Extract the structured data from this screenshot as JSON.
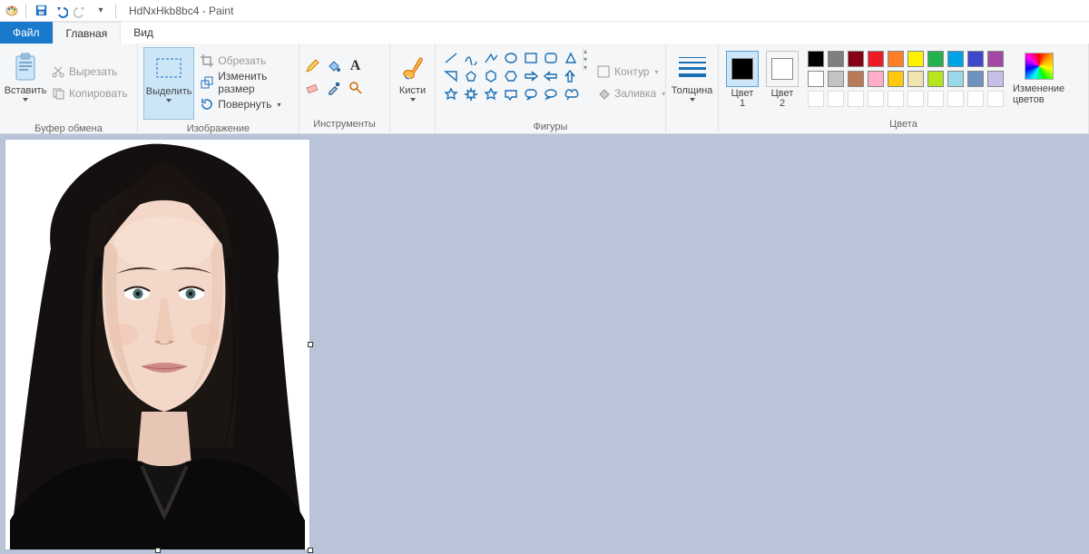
{
  "title": {
    "doc": "HdNxHkb8bc4",
    "app": "Paint",
    "sep": " - "
  },
  "tabs": {
    "file": "Файл",
    "home": "Главная",
    "view": "Вид"
  },
  "groups": {
    "clipboard": "Буфер обмена",
    "image": "Изображение",
    "tools": "Инструменты",
    "shapes": "Фигуры",
    "colors": "Цвета"
  },
  "clipboard": {
    "paste": "Вставить",
    "cut": "Вырезать",
    "copy": "Копировать"
  },
  "image": {
    "select": "Выделить",
    "crop": "Обрезать",
    "resize": "Изменить размер",
    "rotate": "Повернуть"
  },
  "brushes": {
    "label": "Кисти"
  },
  "shape_opts": {
    "outline": "Контур",
    "fill": "Заливка"
  },
  "thickness": {
    "label": "Толщина"
  },
  "colors": {
    "c1": "Цвет\n1",
    "c2": "Цвет\n2",
    "edit": "Изменение\nцветов"
  },
  "palette_row1": [
    "#000000",
    "#7f7f7f",
    "#880015",
    "#ed1c24",
    "#ff7f27",
    "#fff200",
    "#22b14c",
    "#00a2e8",
    "#3f48cc",
    "#a349a4"
  ],
  "palette_row2": [
    "#ffffff",
    "#c3c3c3",
    "#b97a57",
    "#ffaec9",
    "#ffc90e",
    "#efe4b0",
    "#b5e61d",
    "#99d9ea",
    "#7092be",
    "#c8bfe7"
  ]
}
